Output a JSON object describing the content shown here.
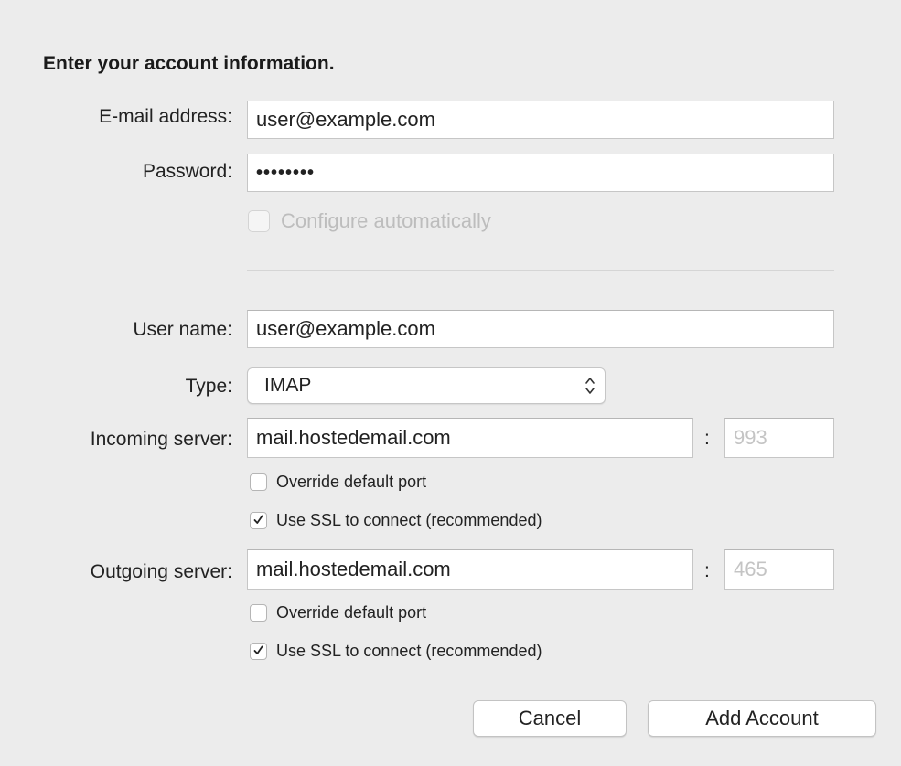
{
  "dialog": {
    "heading": "Enter your account information."
  },
  "account": {
    "email_label": "E-mail address:",
    "email_value": "user@example.com",
    "password_label": "Password:",
    "password_value": "••••••••",
    "configure_auto_label": "Configure automatically",
    "configure_auto_checked": false,
    "configure_auto_enabled": false
  },
  "server": {
    "username_label": "User name:",
    "username_value": "user@example.com",
    "type_label": "Type:",
    "type_value": "IMAP",
    "incoming": {
      "label": "Incoming server:",
      "host": "mail.hostedemail.com",
      "separator": ":",
      "port": "993",
      "override_port_label": "Override default port",
      "override_port_checked": false,
      "ssl_label": "Use SSL to connect (recommended)",
      "ssl_checked": true
    },
    "outgoing": {
      "label": "Outgoing server:",
      "host": "mail.hostedemail.com",
      "separator": ":",
      "port": "465",
      "override_port_label": "Override default port",
      "override_port_checked": false,
      "ssl_label": "Use SSL to connect (recommended)",
      "ssl_checked": true
    }
  },
  "buttons": {
    "cancel": "Cancel",
    "add_account": "Add Account"
  },
  "icons": {
    "select_arrows": "up-down-chevron-icon",
    "checkmark": "checkmark-icon"
  },
  "colors": {
    "background": "#ececec",
    "field_background": "#ffffff",
    "disabled_text": "#c4c4c4"
  }
}
